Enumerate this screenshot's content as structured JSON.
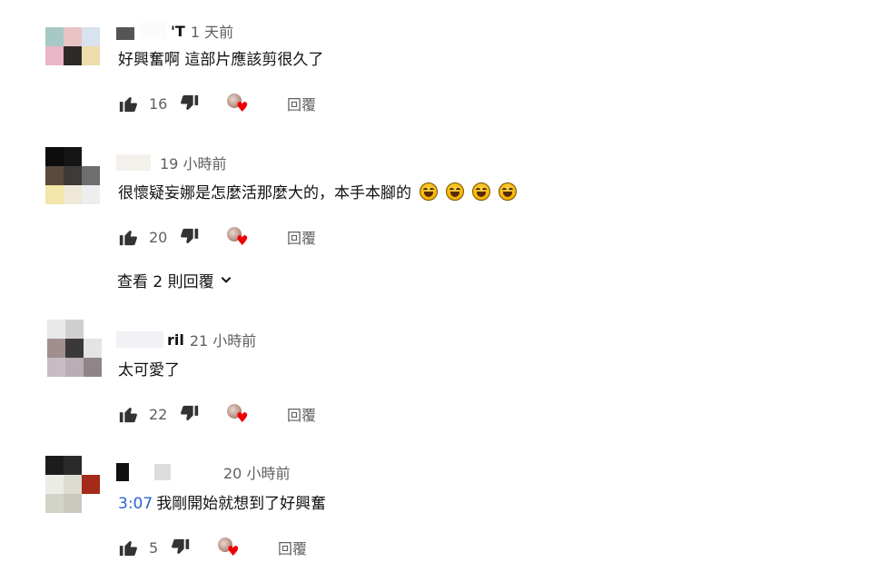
{
  "comments": [
    {
      "author": "'T",
      "time": "1 天前",
      "text": "好興奮啊 這部片應該剪很久了",
      "timestamp_link": "",
      "likes": "16",
      "reply_label": "回覆"
    },
    {
      "author": "",
      "time": "19 小時前",
      "text": "很懷疑妄娜是怎麼活那麼大的，本手本腳的",
      "timestamp_link": "",
      "likes": "20",
      "reply_label": "回覆",
      "emoji_count": 4
    },
    {
      "author": "ril",
      "time": "21 小時前",
      "text": "太可愛了",
      "timestamp_link": "",
      "likes": "22",
      "reply_label": "回覆"
    },
    {
      "author": "",
      "time": "20 小時前",
      "text": "我剛開始就想到了好興奮",
      "timestamp_link": "3:07",
      "likes": "5",
      "reply_label": "回覆"
    }
  ],
  "view_replies": {
    "label": "查看 2 則回覆"
  },
  "colors": {
    "timestamp_link": "#2a62d4",
    "heart": "#ee0000",
    "meta_text": "#606060"
  },
  "icons": {
    "like": "thumbs-up-icon",
    "dislike": "thumbs-down-icon",
    "creator_heart": "heart-icon",
    "expand": "chevron-down-icon",
    "emoji": "laughing-emoji-icon"
  }
}
